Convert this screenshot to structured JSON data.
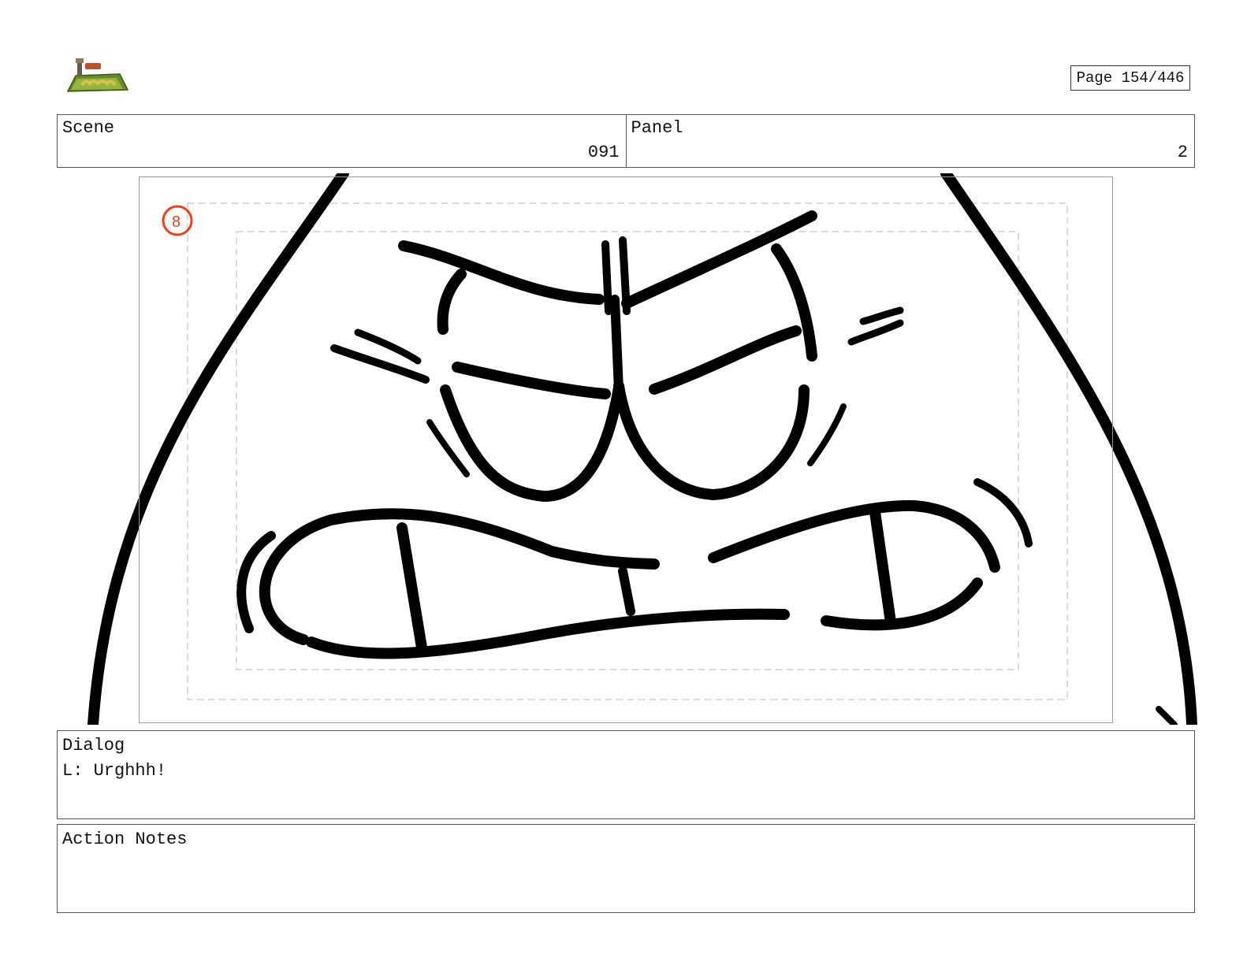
{
  "header": {
    "page_label": "Page 154/446"
  },
  "scene": {
    "label": "Scene",
    "value": "091"
  },
  "panel": {
    "label": "Panel",
    "value": "2"
  },
  "dialog": {
    "label": "Dialog",
    "text": "L: Urghhh!"
  },
  "action_notes": {
    "label": "Action Notes",
    "text": ""
  },
  "drawing": {
    "subject": "angry-face-sketch",
    "mark_number": "8",
    "mark_color": "#e8431e"
  }
}
